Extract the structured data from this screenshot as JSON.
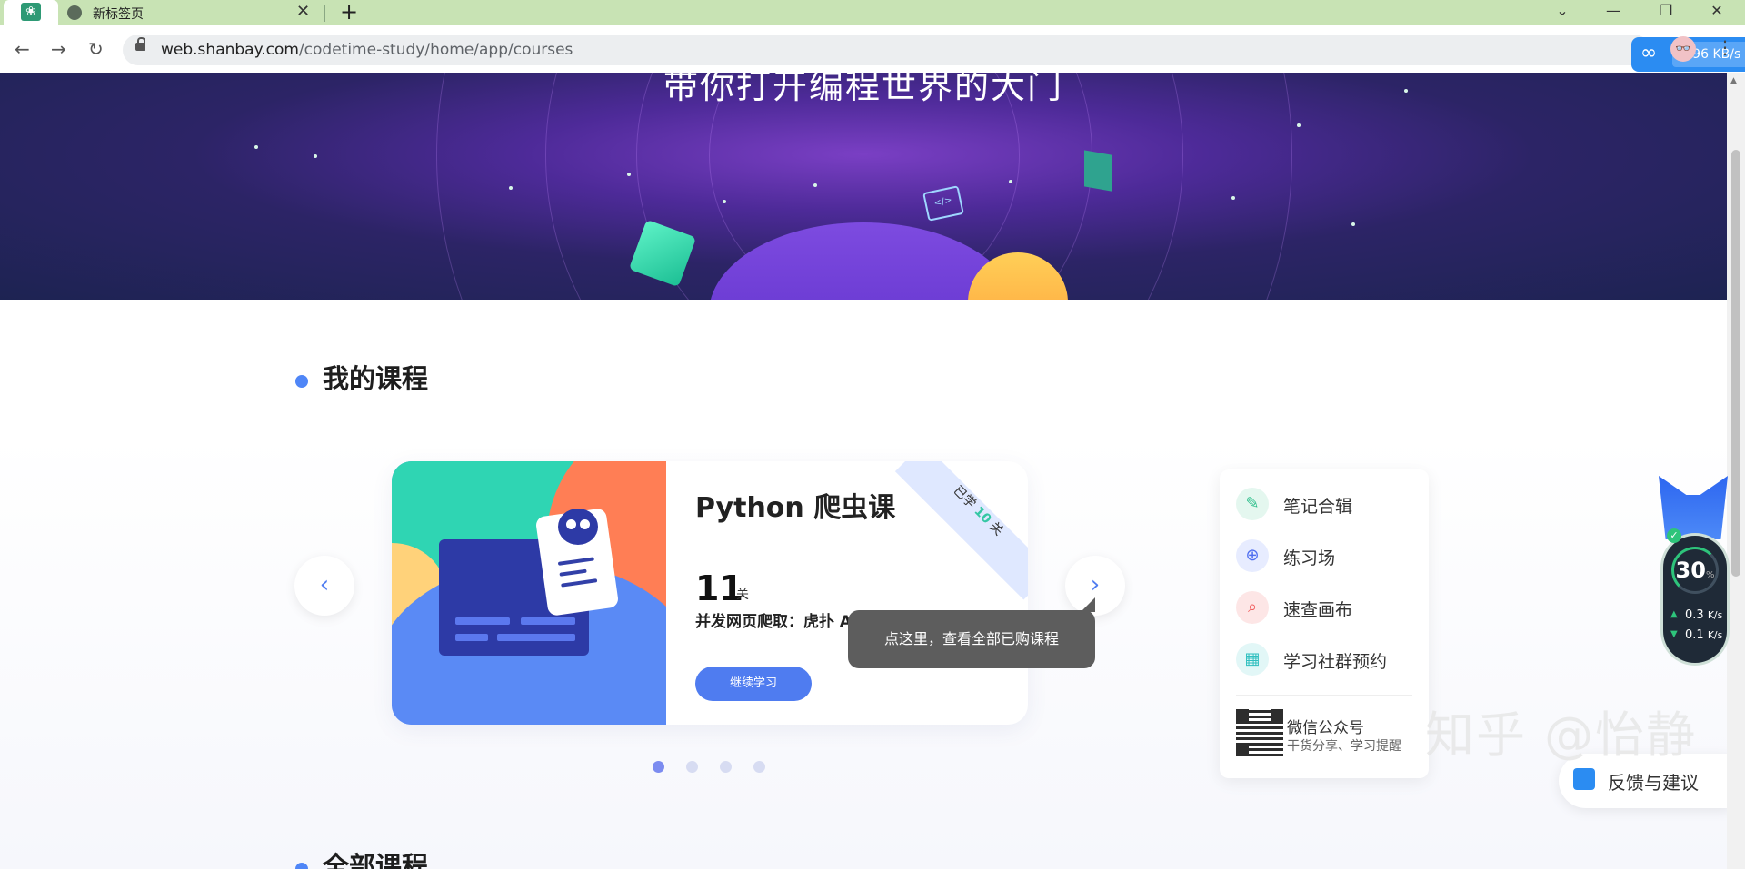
{
  "browser": {
    "tab_title": "新标签页",
    "tab_close": "✕",
    "new_tab": "+",
    "url_host": "web.shanbay.com",
    "url_path": "/codetime-study/home/app/courses",
    "download_speed": "⬇ 96 KB/s"
  },
  "banner": {
    "title": "带你打开编程世界的大门"
  },
  "my_courses": {
    "heading": "我的课程",
    "card": {
      "title": "Python 爬虫课",
      "corner_prefix": "已学",
      "corner_count": "10",
      "corner_suffix": "关",
      "level_count": "11",
      "level_unit": "关",
      "description": "并发网页爬取：虎扑 ACG 帖子",
      "button": "继续学习"
    },
    "tooltip": "点这里，查看全部已购课程",
    "pagination_total": 4,
    "pagination_active": 0
  },
  "side_panel": {
    "items": [
      {
        "label": "笔记合辑",
        "icon": "note-icon",
        "color": "#2fbf8c"
      },
      {
        "label": "练习场",
        "icon": "target-icon",
        "color": "#4f6ef0"
      },
      {
        "label": "速查画布",
        "icon": "search-doc-icon",
        "color": "#f05a5a"
      },
      {
        "label": "学习社群预约",
        "icon": "calendar-icon",
        "color": "#2fbfbf"
      }
    ],
    "wechat_title": "微信公众号",
    "wechat_sub": "干货分享、学习提醒"
  },
  "all_courses": {
    "heading": "全部课程"
  },
  "overlay": {
    "feedback": "反馈与建议",
    "watermark": "知乎 @怡静",
    "speed_percent": "30",
    "speed_percent_unit": "%",
    "speed_up": "0.3",
    "speed_down": "0.1",
    "speed_unit": "K/s"
  },
  "colors": {
    "accent": "#4f7cf0",
    "section_dot": "#4f86f7"
  }
}
